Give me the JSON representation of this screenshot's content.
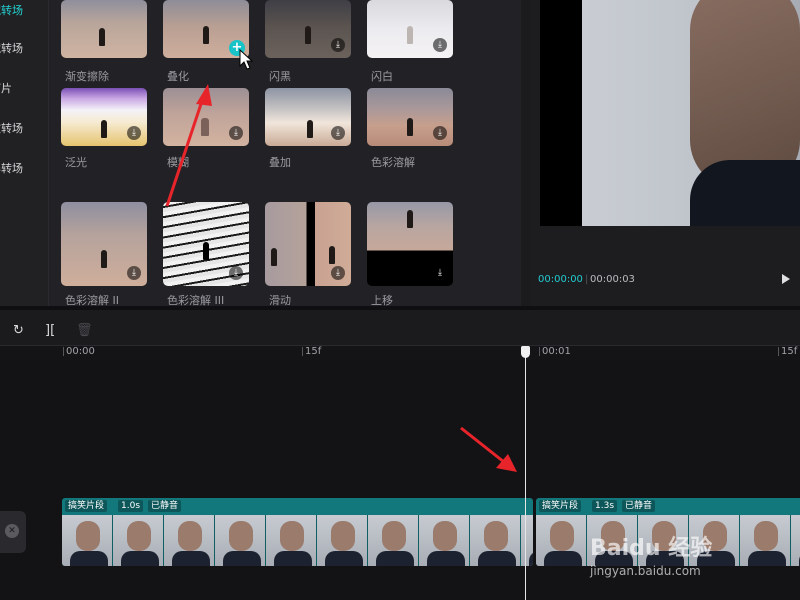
{
  "sidebar": {
    "items": [
      {
        "label": "镜转场",
        "active": true
      },
      {
        "label": "镜转场",
        "active": false
      },
      {
        "label": "灯片",
        "active": false
      },
      {
        "label": "故转场",
        "active": false
      },
      {
        "label": "屏转场",
        "active": false
      }
    ]
  },
  "transitions": [
    {
      "label": "渐变擦除",
      "state": "download"
    },
    {
      "label": "叠化",
      "state": "add"
    },
    {
      "label": "闪黑",
      "state": "download"
    },
    {
      "label": "闪白",
      "state": "download"
    },
    {
      "label": "泛光",
      "state": "download"
    },
    {
      "label": "模糊",
      "state": "download"
    },
    {
      "label": "叠加",
      "state": "download"
    },
    {
      "label": "色彩溶解",
      "state": "download"
    },
    {
      "label": "色彩溶解 II",
      "state": "download"
    },
    {
      "label": "色彩溶解 III",
      "state": "download"
    },
    {
      "label": "滑动",
      "state": "download"
    },
    {
      "label": "上移",
      "state": "download"
    }
  ],
  "icons": {
    "download": "⤓",
    "add": "+",
    "redo": "↻",
    "split": "][",
    "delete": "🗑"
  },
  "player": {
    "current_time": "00:00:00",
    "duration": "00:00:03"
  },
  "ruler": {
    "ticks": [
      "00:00",
      "15f",
      "00:01",
      "15f"
    ]
  },
  "clips": [
    {
      "name": "搞笑片段",
      "duration": "1.0s",
      "status": "已静音"
    },
    {
      "name": "搞笑片段",
      "duration": "1.3s",
      "status": "已静音"
    }
  ],
  "watermark": {
    "brand": "Baidu 经验",
    "url": "jingyan.baidu.com"
  },
  "colors": {
    "accent": "#22d3d3",
    "clip": "#12787c",
    "annotation_arrow": "#e8242b"
  }
}
